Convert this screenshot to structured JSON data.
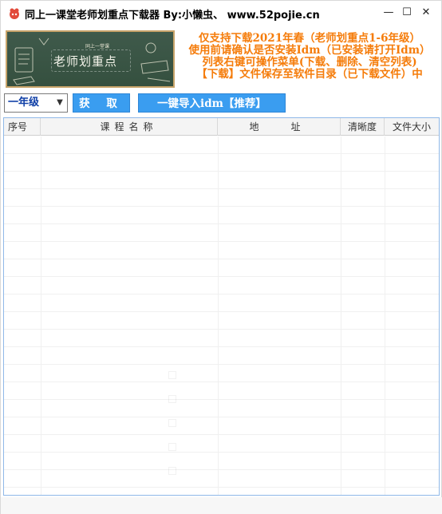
{
  "window": {
    "title": "同上一课堂老师划重点下载器  By:小懒虫、  www.52pojie.cn",
    "minimize_glyph": "—",
    "maximize_glyph": "☐",
    "close_glyph": "✕"
  },
  "banner": {
    "title": "老师划重点",
    "subtitle": "同上一堂课"
  },
  "notice": {
    "lines": [
      "仅支持下载2021年春（老师划重点1-6年级）",
      "使用前请确认是否安装Idm（已安装请打开Idm）",
      "列表右键可操作菜单(下载、删除、清空列表)",
      "【下载】文件保存至软件目录（已下载文件）中"
    ]
  },
  "controls": {
    "grade_selected": "一年级",
    "download_label": "获 取",
    "idm_label": "一键导入idm【推荐】"
  },
  "table": {
    "columns": [
      "序号",
      "课程名称",
      "地址",
      "清晰度",
      "文件大小"
    ],
    "rows": []
  },
  "colors": {
    "accent_blue": "#3a9df0",
    "notice_orange": "#f57c0a",
    "banner_green": "#3f5a4b"
  }
}
